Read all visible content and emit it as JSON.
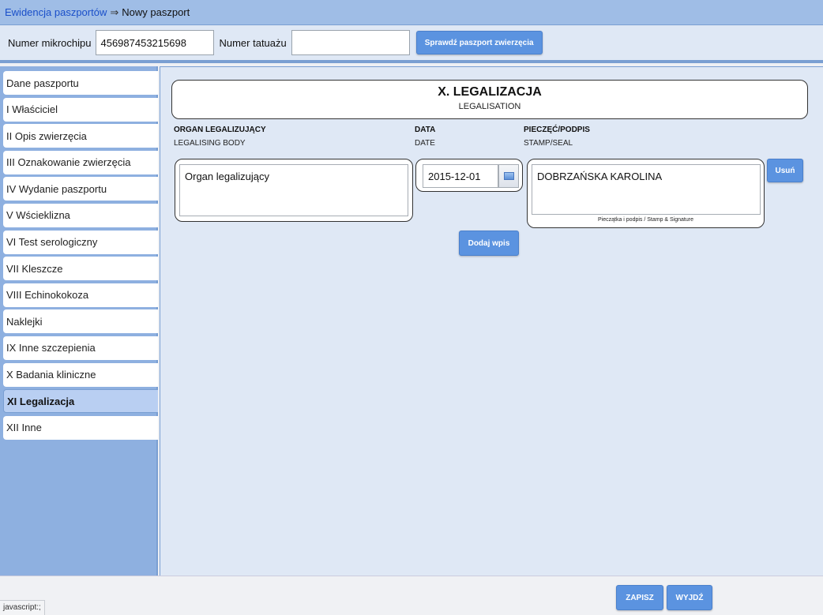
{
  "breadcrumb": {
    "link": "Ewidencja paszportów",
    "separator": "⇒",
    "current": "Nowy paszport"
  },
  "search": {
    "chip_label": "Numer mikrochipu",
    "chip_value": "456987453215698",
    "tattoo_label": "Numer tatuażu",
    "tattoo_value": "",
    "check_button": "Sprawdź paszport zwierzęcia"
  },
  "sidebar": {
    "items": [
      {
        "label": "Dane paszportu"
      },
      {
        "label": "I Właściciel"
      },
      {
        "label": "II Opis zwierzęcia"
      },
      {
        "label": "III Oznakowanie zwierzęcia"
      },
      {
        "label": "IV Wydanie paszportu"
      },
      {
        "label": "V Wścieklizna"
      },
      {
        "label": "VI Test serologiczny"
      },
      {
        "label": "VII Kleszcze"
      },
      {
        "label": "VIII Echinokokoza"
      },
      {
        "label": "Naklejki"
      },
      {
        "label": "IX Inne szczepienia"
      },
      {
        "label": "X Badania kliniczne"
      },
      {
        "label": "XI Legalizacja"
      },
      {
        "label": "XII Inne"
      }
    ],
    "active_index": 12
  },
  "section": {
    "title": "X. LEGALIZACJA",
    "subtitle": "LEGALISATION",
    "columns": {
      "organ": {
        "head": "ORGAN LEGALIZUJĄCY",
        "sub": "LEGALISING BODY"
      },
      "date": {
        "head": "DATA",
        "sub": "DATE"
      },
      "stamp": {
        "head": "PIECZĘĆ/PODPIS",
        "sub": "STAMP/SEAL"
      }
    },
    "entry": {
      "organ_placeholder": "Organ legalizujący",
      "date_value": "2015-12-01",
      "stamp_value": "DOBRZAŃSKA KAROLINA",
      "stamp_caption": "Pieczątka i podpis / Stamp & Signature"
    },
    "delete_button": "Usuń",
    "add_button": "Dodaj wpis"
  },
  "footer": {
    "save_button": "ZAPISZ",
    "exit_button": "WYJDŹ"
  },
  "status": "javascript:;"
}
